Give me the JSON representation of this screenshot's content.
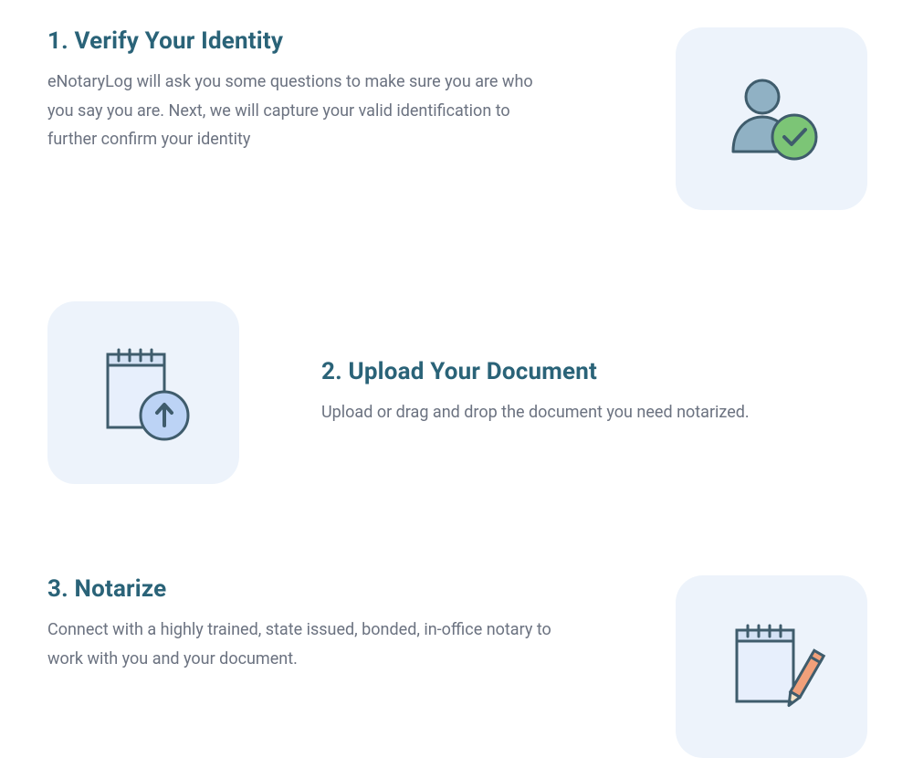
{
  "steps": [
    {
      "title": "1. Verify Your Identity",
      "desc": "eNotaryLog will ask you some questions to make sure you are who you say you are. Next, we will capture your valid identification to further confirm your identity"
    },
    {
      "title": "2. Upload Your Document",
      "desc": "Upload or drag and drop the document you need notarized."
    },
    {
      "title": "3. Notarize",
      "desc": "Connect with a highly trained, state issued, bonded, in-office notary to work with you and your document."
    }
  ]
}
